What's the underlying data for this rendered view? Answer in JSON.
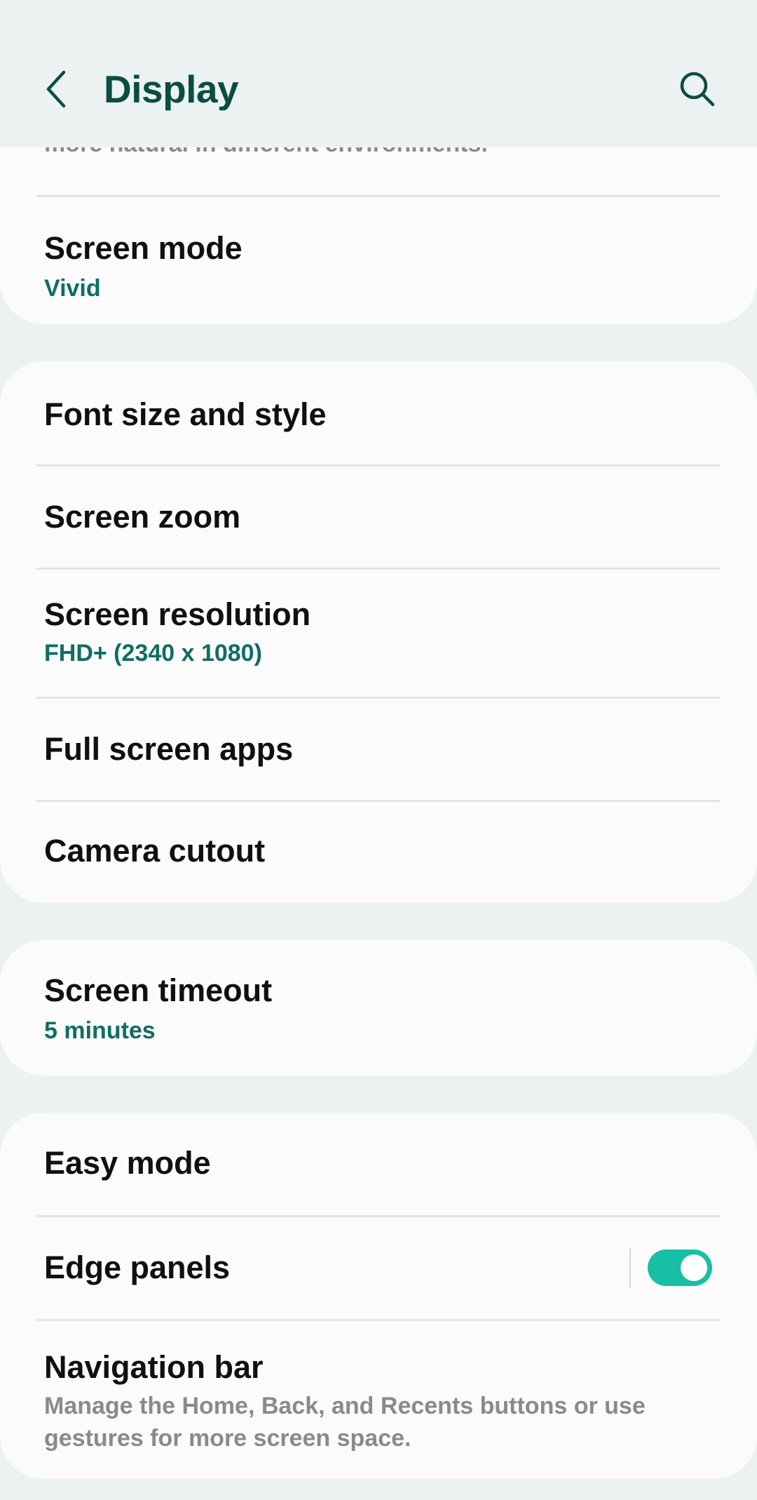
{
  "header": {
    "title": "Display",
    "back_icon": "chevron-left-icon",
    "search_icon": "search-icon"
  },
  "truncated_text": "more natural in different environments.",
  "items": {
    "screen_mode": {
      "label": "Screen mode",
      "value": "Vivid"
    },
    "font_size": {
      "label": "Font size and style"
    },
    "screen_zoom": {
      "label": "Screen zoom"
    },
    "screen_resolution": {
      "label": "Screen resolution",
      "value": "FHD+ (2340 x 1080)"
    },
    "full_screen_apps": {
      "label": "Full screen apps"
    },
    "camera_cutout": {
      "label": "Camera cutout"
    },
    "screen_timeout": {
      "label": "Screen timeout",
      "value": "5 minutes"
    },
    "easy_mode": {
      "label": "Easy mode"
    },
    "edge_panels": {
      "label": "Edge panels",
      "enabled": true
    },
    "navigation_bar": {
      "label": "Navigation bar",
      "description": "Manage the Home, Back, and Recents buttons or use gestures for more screen space."
    }
  },
  "colors": {
    "background": "#ecf2f1",
    "card": "#fbfbfb",
    "title": "#0b4d43",
    "accent_text": "#0f6e62",
    "toggle_on": "#17bfa5"
  }
}
